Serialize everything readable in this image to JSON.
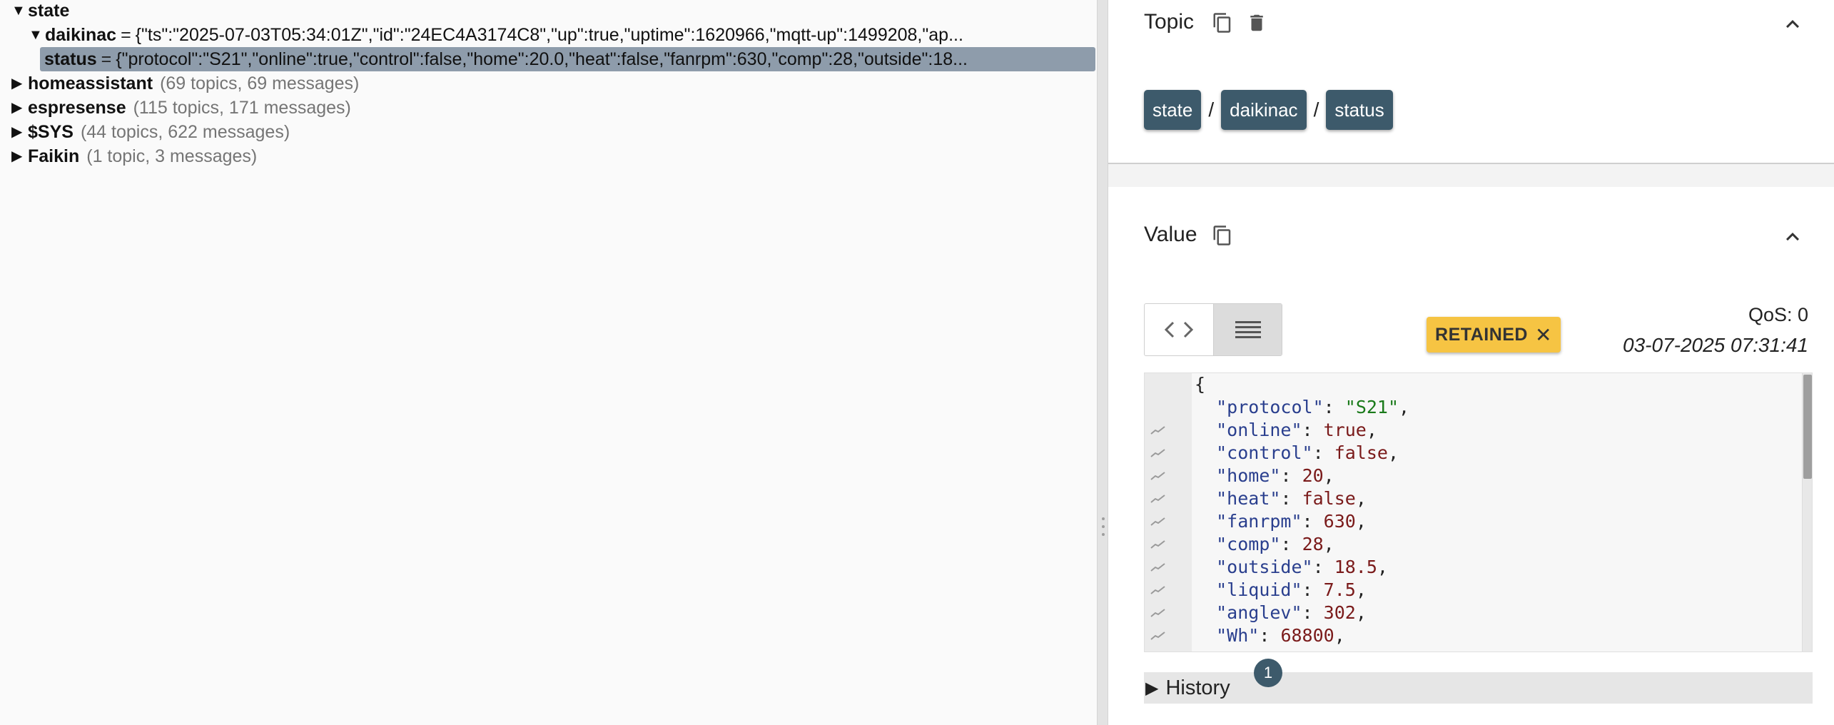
{
  "tree": {
    "nodes": [
      {
        "name": "state",
        "expanded": true
      },
      {
        "name": "daikinac",
        "expanded": true,
        "value": "{\"ts\":\"2025-07-03T05:34:01Z\",\"id\":\"24EC4A3174C8\",\"up\":true,\"uptime\":1620966,\"mqtt-up\":1499208,\"ap..."
      },
      {
        "name": "status",
        "value": "{\"protocol\":\"S21\",\"online\":true,\"control\":false,\"home\":20.0,\"heat\":false,\"fanrpm\":630,\"comp\":28,\"outside\":18..."
      },
      {
        "name": "homeassistant",
        "meta": "(69 topics, 69 messages)"
      },
      {
        "name": "espresense",
        "meta": "(115 topics, 171 messages)"
      },
      {
        "name": "$SYS",
        "meta": "(44 topics, 622 messages)"
      },
      {
        "name": "Faikin",
        "meta": "(1 topic, 3 messages)"
      }
    ]
  },
  "topic_panel": {
    "title": "Topic",
    "path": [
      "state",
      "daikinac",
      "status"
    ],
    "separator": "/"
  },
  "value_panel": {
    "title": "Value",
    "retained_label": "RETAINED",
    "retained_close": "✕",
    "qos": "QoS: 0",
    "timestamp": "03-07-2025 07:31:41",
    "json_lines": [
      {
        "type": "brace",
        "text": "{"
      },
      {
        "key": "protocol",
        "value": "\"S21\"",
        "vtype": "s",
        "chart": false
      },
      {
        "key": "online",
        "value": "true",
        "vtype": "b",
        "chart": true
      },
      {
        "key": "control",
        "value": "false",
        "vtype": "b",
        "chart": true
      },
      {
        "key": "home",
        "value": "20",
        "vtype": "b",
        "chart": true
      },
      {
        "key": "heat",
        "value": "false",
        "vtype": "b",
        "chart": true
      },
      {
        "key": "fanrpm",
        "value": "630",
        "vtype": "b",
        "chart": true
      },
      {
        "key": "comp",
        "value": "28",
        "vtype": "b",
        "chart": true
      },
      {
        "key": "outside",
        "value": "18.5",
        "vtype": "b",
        "chart": true
      },
      {
        "key": "liquid",
        "value": "7.5",
        "vtype": "b",
        "chart": true
      },
      {
        "key": "anglev",
        "value": "302",
        "vtype": "b",
        "chart": true
      },
      {
        "key": "Wh",
        "value": "68800",
        "vtype": "b",
        "chart": true
      }
    ],
    "history_label": "History",
    "history_count": "1"
  },
  "colors": {
    "chip": "#3d5a6b",
    "retained": "#f6c443",
    "selected_row": "#8e9cab"
  }
}
